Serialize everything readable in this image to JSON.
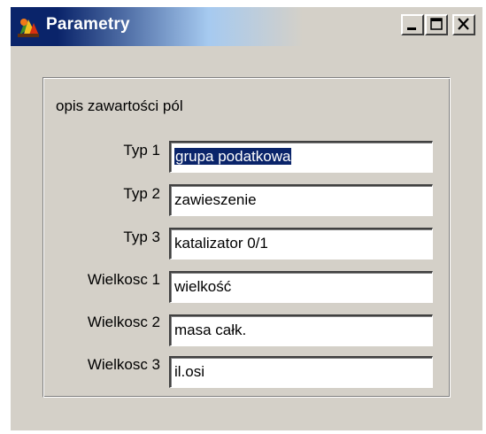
{
  "window": {
    "title": "Parametry",
    "icon": "colorful-app-icon",
    "controls": {
      "minimize": "minimize-icon",
      "maximize": "maximize-icon",
      "close": "close-icon"
    }
  },
  "group": {
    "caption": "opis zawartości pól",
    "rows": [
      {
        "label": "Typ 1",
        "value": "grupa podatkowa",
        "selected": true
      },
      {
        "label": "Typ 2",
        "value": "zawieszenie"
      },
      {
        "label": "Typ 3",
        "value": "katalizator 0/1"
      },
      {
        "label": "Wielkosc 1",
        "value": "wielkość"
      },
      {
        "label": "Wielkosc 2",
        "value": "masa całk."
      },
      {
        "label": "Wielkosc 3",
        "value": "il.osi"
      }
    ]
  },
  "colors": {
    "titlebar_start": "#0a246a",
    "titlebar_end": "#d4d0c8",
    "window_face": "#d4d0c8",
    "selection": "#0a246a"
  }
}
